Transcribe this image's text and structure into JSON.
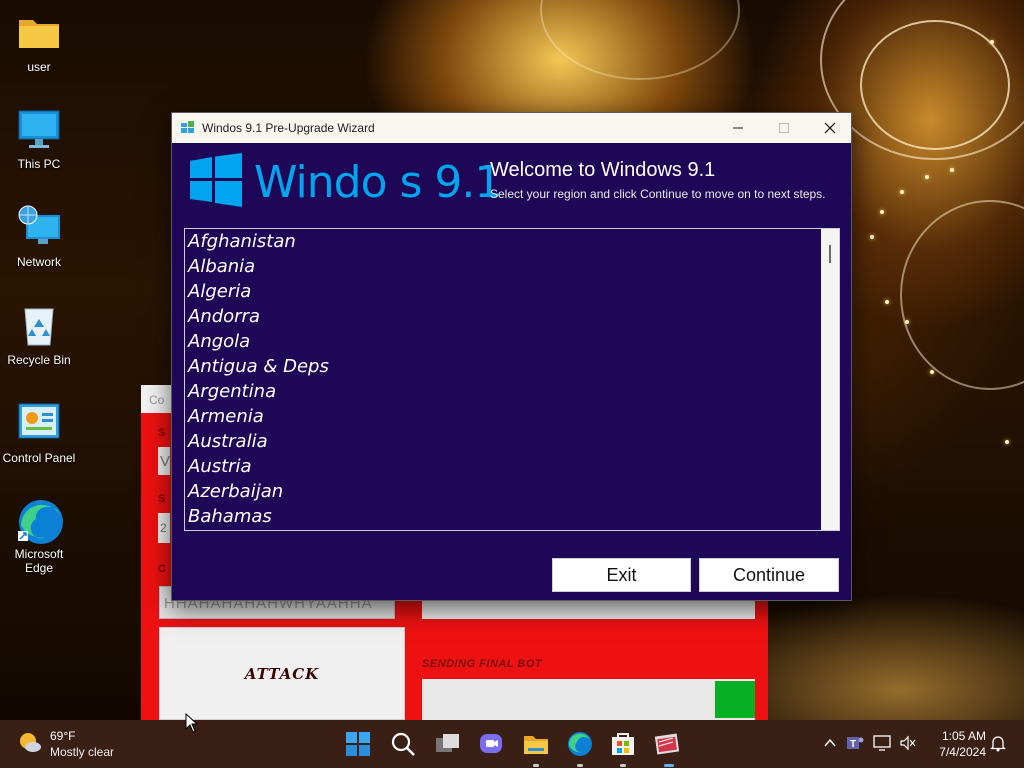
{
  "desktop": {
    "icons": [
      {
        "label": "user",
        "icon": "folder-icon"
      },
      {
        "label": "This PC",
        "icon": "monitor-icon"
      },
      {
        "label": "Network",
        "icon": "network-icon"
      },
      {
        "label": "Recycle Bin",
        "icon": "recycle-bin-icon"
      },
      {
        "label": "Control Panel",
        "icon": "control-panel-icon"
      },
      {
        "label": "Microsoft Edge",
        "icon": "edge-icon"
      }
    ]
  },
  "background_app": {
    "title_fragment": "Co",
    "input_value": "HHAHAHAHAHWHYAAHHA",
    "attack_label": "ATTACK",
    "sending_label": "SENDING FINAL BOT",
    "progress_fraction": 0.12,
    "accent_color": "#ee1111"
  },
  "wizard": {
    "title": "Windos 9.1 Pre-Upgrade Wizard",
    "logo_text": "Windo  s 9.1",
    "welcome": "Welcome to Windows 9.1",
    "instructions": "Select your region and click Continue to move on to next steps.",
    "countries": [
      "Afghanistan",
      "Albania",
      "Algeria",
      "Andorra",
      "Angola",
      "Antigua & Deps",
      "Argentina",
      "Armenia",
      "Australia",
      "Austria",
      "Azerbaijan",
      "Bahamas"
    ],
    "exit_label": "Exit",
    "continue_label": "Continue",
    "background_color": "#1e0757",
    "logo_color": "#00a4ef"
  },
  "taskbar": {
    "weather_temp": "69°F",
    "weather_cond": "Mostly clear",
    "apps": [
      "start-icon",
      "search-icon",
      "task-view-icon",
      "chat-icon",
      "file-explorer-icon",
      "edge-icon",
      "store-icon",
      "app-icon"
    ],
    "time": "1:05 AM",
    "date": "7/4/2024"
  }
}
